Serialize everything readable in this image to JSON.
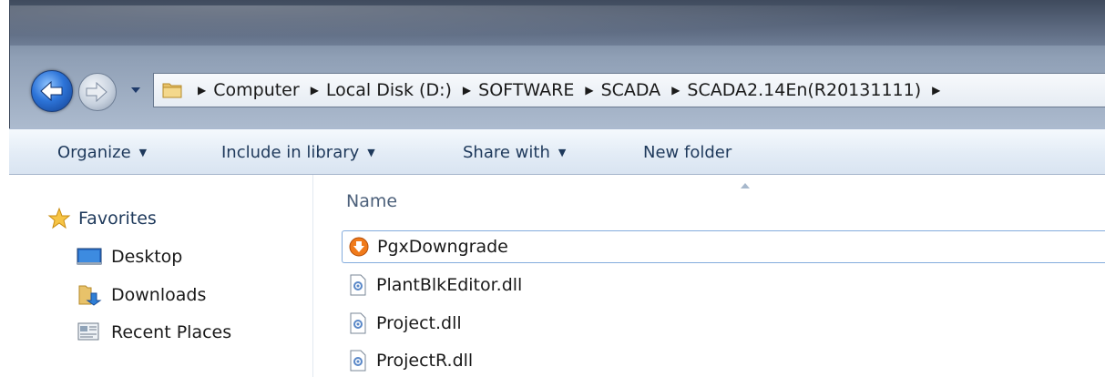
{
  "navigation": {
    "back_icon": "back-arrow-icon",
    "forward_icon": "forward-arrow-icon",
    "recent_icon": "chevron-down-icon"
  },
  "address_bar": {
    "folder_icon": "folder-icon",
    "crumbs": [
      "Computer",
      "Local Disk (D:)",
      "SOFTWARE",
      "SCADA",
      "SCADA2.14En(R20131111)"
    ],
    "separator": "▶"
  },
  "command_bar": {
    "organize": "Organize",
    "include_in_library": "Include in library",
    "share_with": "Share with",
    "new_folder": "New folder"
  },
  "nav_pane": {
    "favorites": "Favorites",
    "items": [
      {
        "label": "Desktop",
        "icon": "desktop-icon"
      },
      {
        "label": "Downloads",
        "icon": "downloads-folder-icon"
      },
      {
        "label": "Recent Places",
        "icon": "recent-places-icon"
      }
    ]
  },
  "file_list": {
    "column_header": "Name",
    "files": [
      {
        "name": "PgxDowngrade",
        "icon": "installer-icon",
        "selected": true
      },
      {
        "name": "PlantBlkEditor.dll",
        "icon": "dll-file-icon"
      },
      {
        "name": "Project.dll",
        "icon": "dll-file-icon"
      },
      {
        "name": "ProjectR.dll",
        "icon": "dll-file-icon"
      }
    ]
  },
  "colors": {
    "command_text": "#1e395b",
    "selection_border": "#84acdd",
    "back_button": "#2d74d8"
  }
}
